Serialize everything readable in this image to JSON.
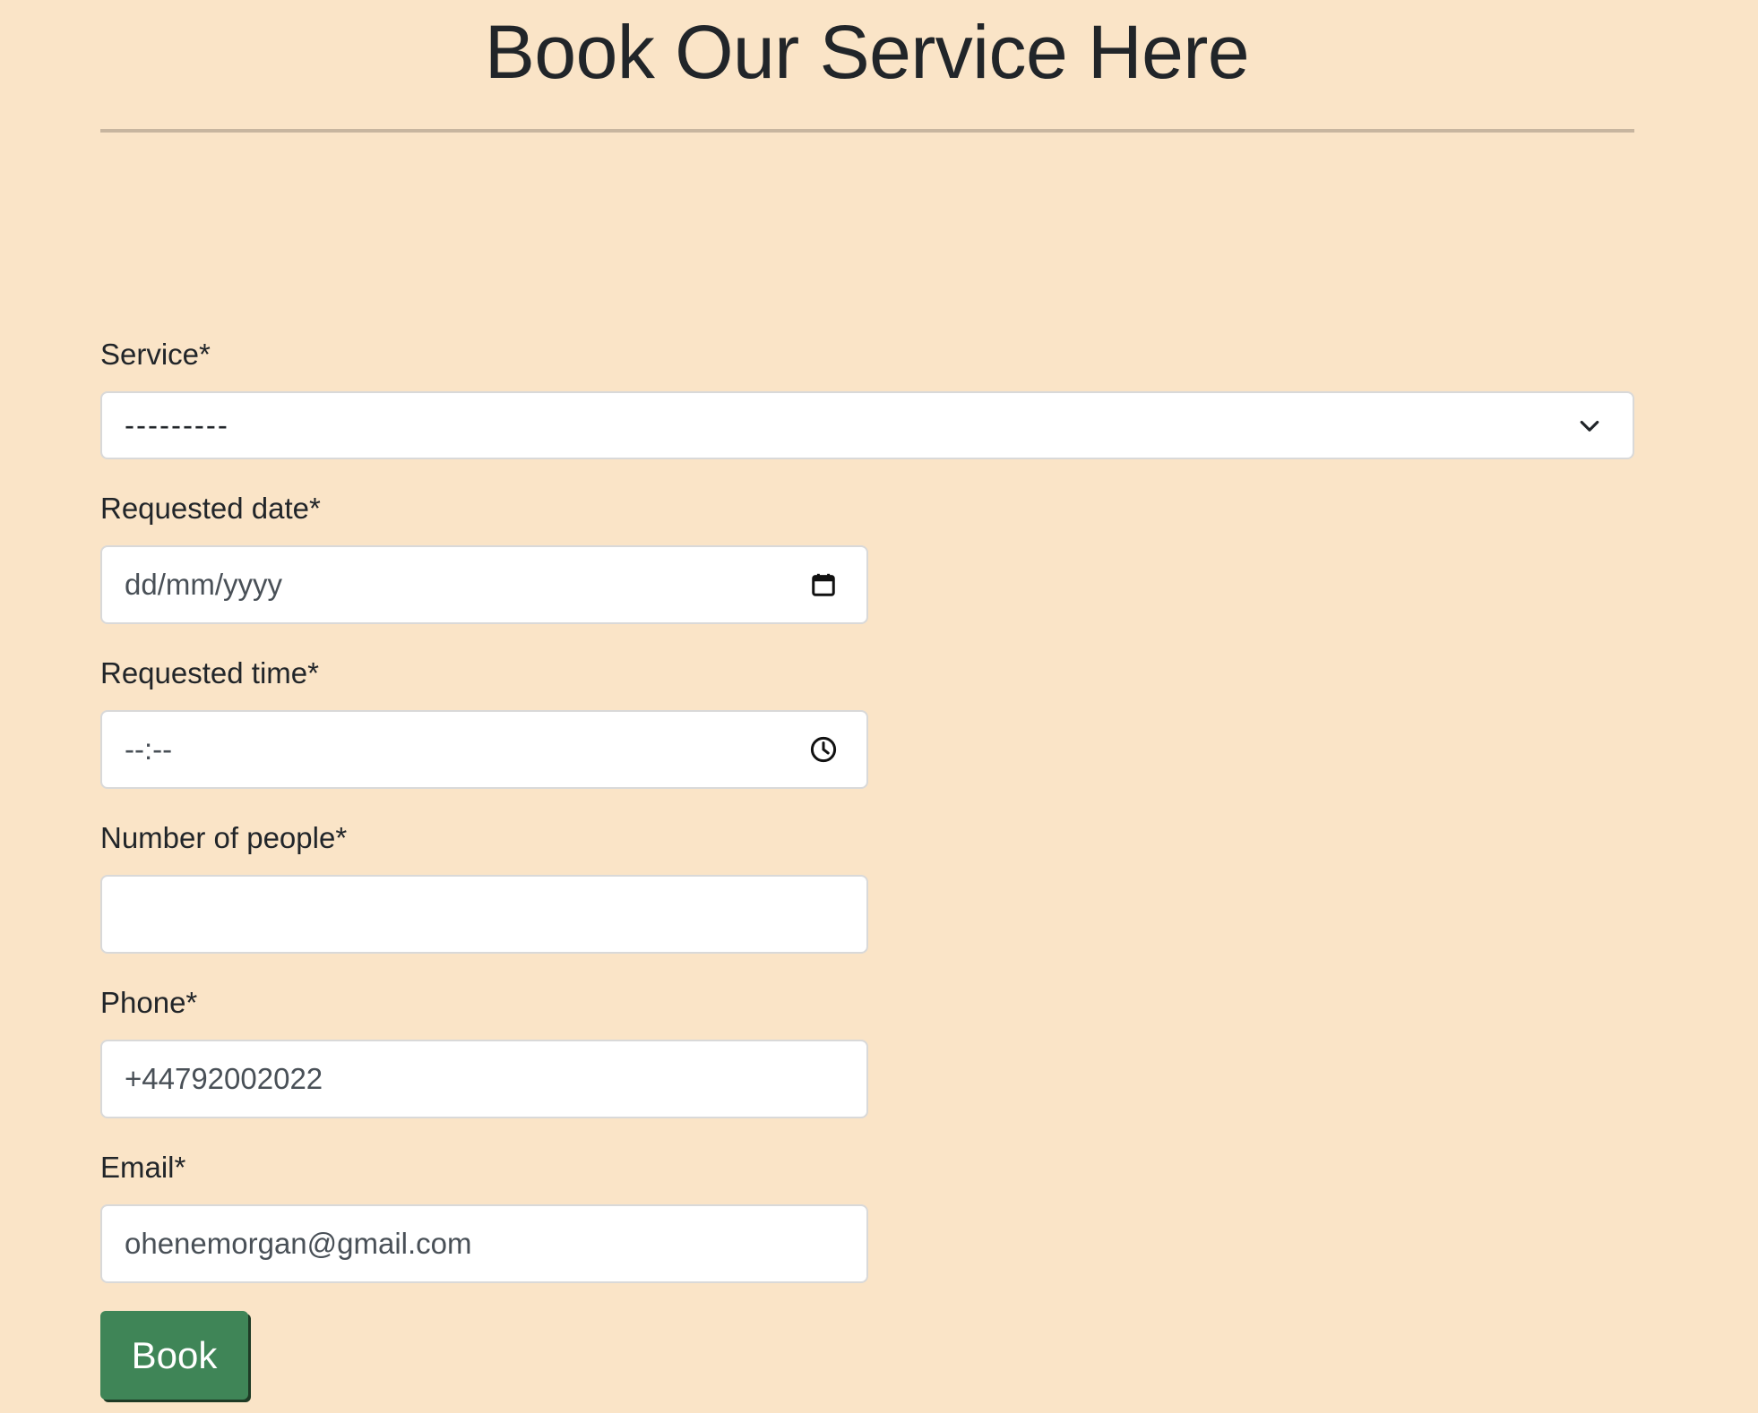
{
  "page": {
    "title": "Book Our Service Here"
  },
  "form": {
    "service": {
      "label": "Service*",
      "selected": "---------"
    },
    "requested_date": {
      "label": "Requested date*",
      "placeholder": "dd/mm/yyyy"
    },
    "requested_time": {
      "label": "Requested time*",
      "placeholder": "--:--"
    },
    "number_of_people": {
      "label": "Number of people*",
      "value": ""
    },
    "phone": {
      "label": "Phone*",
      "value": "+44792002022"
    },
    "email": {
      "label": "Email*",
      "value": "ohenemorgan@gmail.com"
    },
    "submit_label": "Book"
  },
  "icons": {
    "service_select": "chevron-down-icon",
    "requested_date": "calendar-icon",
    "requested_time": "clock-icon"
  },
  "colors": {
    "background": "#fae4c7",
    "button": "#3f8557",
    "divider": "#c7b59f"
  }
}
